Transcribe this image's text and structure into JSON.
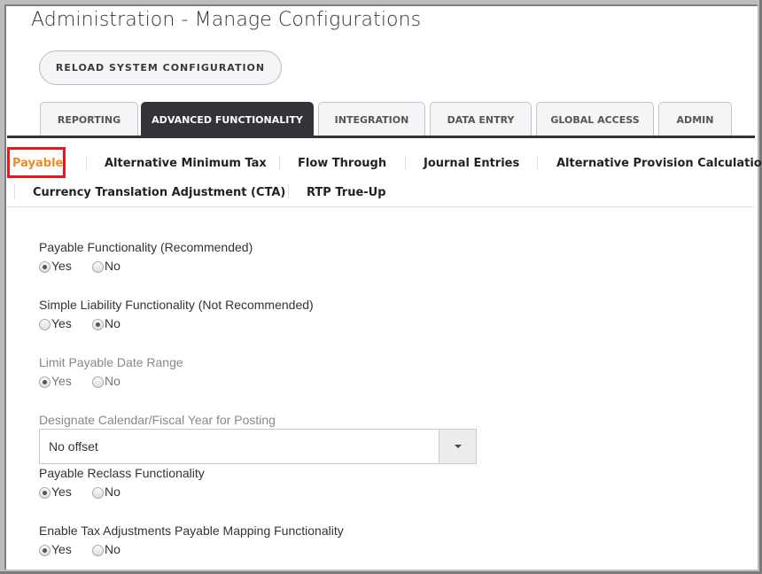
{
  "page": {
    "title": "Administration - Manage Configurations"
  },
  "toolbar": {
    "reload_label": "RELOAD SYSTEM CONFIGURATION"
  },
  "tabs": [
    {
      "label": "REPORTING",
      "active": false
    },
    {
      "label": "ADVANCED FUNCTIONALITY",
      "active": true
    },
    {
      "label": "INTEGRATION",
      "active": false
    },
    {
      "label": "DATA ENTRY",
      "active": false
    },
    {
      "label": "GLOBAL ACCESS",
      "active": false
    },
    {
      "label": "ADMIN",
      "active": false
    }
  ],
  "subnav": [
    {
      "label": "Payable",
      "active": true
    },
    {
      "label": "Alternative Minimum Tax",
      "active": false
    },
    {
      "label": "Flow Through",
      "active": false
    },
    {
      "label": "Journal Entries",
      "active": false
    },
    {
      "label": "Alternative Provision Calculations",
      "active": false
    },
    {
      "label": "Currency Translation Adjustment (CTA)",
      "active": false
    },
    {
      "label": "RTP True-Up",
      "active": false
    }
  ],
  "colors": {
    "accent": "#f08a24",
    "highlight_box": "#e8171e",
    "active_tab": "#333438"
  },
  "settings": [
    {
      "label": "Payable Functionality (Recommended)",
      "yes_label": "Yes",
      "no_label": "No",
      "value": "Yes",
      "disabled": false
    },
    {
      "label": "Simple Liability Functionality (Not Recommended)",
      "yes_label": "Yes",
      "no_label": "No",
      "value": "No",
      "disabled": false
    },
    {
      "label": "Limit Payable Date Range",
      "yes_label": "Yes",
      "no_label": "No",
      "value": "Yes",
      "disabled": true
    },
    {
      "label": "Designate Calendar/Fiscal Year for Posting",
      "select_value": "No offset",
      "disabled": true
    },
    {
      "label": "Payable Reclass Functionality",
      "yes_label": "Yes",
      "no_label": "No",
      "value": "Yes",
      "disabled": false
    },
    {
      "label": "Enable Tax Adjustments Payable Mapping Functionality",
      "yes_label": "Yes",
      "no_label": "No",
      "value": "Yes",
      "disabled": false
    }
  ]
}
